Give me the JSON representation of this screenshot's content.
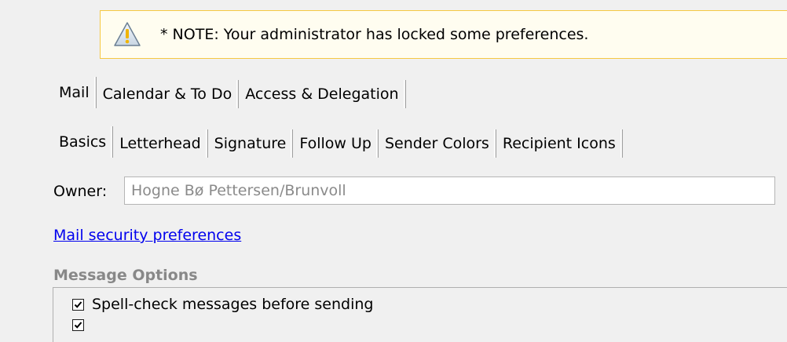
{
  "notice": {
    "icon": "warning-icon",
    "text": "* NOTE: Your administrator has locked some preferences."
  },
  "main_tabs": [
    {
      "label": "Mail",
      "selected": true
    },
    {
      "label": "Calendar & To Do",
      "selected": false
    },
    {
      "label": "Access & Delegation",
      "selected": false
    }
  ],
  "sub_tabs": [
    {
      "label": "Basics",
      "selected": true
    },
    {
      "label": "Letterhead",
      "selected": false
    },
    {
      "label": "Signature",
      "selected": false
    },
    {
      "label": "Follow Up",
      "selected": false
    },
    {
      "label": "Sender Colors",
      "selected": false
    },
    {
      "label": "Recipient Icons",
      "selected": false
    }
  ],
  "owner": {
    "label": "Owner:",
    "value": "Hogne Bø Pettersen/Brunvoll"
  },
  "security_link": "Mail security preferences",
  "message_options": {
    "heading": "Message Options",
    "items": [
      {
        "label": "Spell-check messages before sending",
        "checked": true
      },
      {
        "label": "",
        "checked": true
      }
    ]
  },
  "colors": {
    "notice_border": "#f5c842",
    "notice_background": "#fffdf0",
    "link": "#0000ee",
    "heading": "#888888",
    "owner_value": "#8a8a8a"
  }
}
